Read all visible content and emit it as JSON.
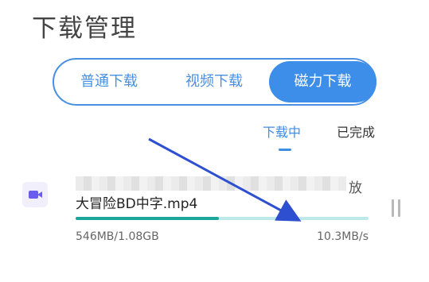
{
  "header": {
    "title": "下载管理"
  },
  "segmented": {
    "tabs": [
      {
        "label": "普通下载"
      },
      {
        "label": "视频下载"
      },
      {
        "label": "磁力下载"
      }
    ],
    "active": "磁力下载"
  },
  "subtabs": {
    "downloading": "下载中",
    "completed": "已完成"
  },
  "download_item": {
    "icon": "video-camera-icon",
    "filename": "大冒险BD中字.mp4",
    "blurred_suffix": "放",
    "downloaded_size": "546MB/1.08GB",
    "speed": "10.3MB/s",
    "progress_fraction": 0.49
  },
  "colors": {
    "accent": "#3d8ee8",
    "progress": "#1aa79a",
    "arrow": "#2f4fd1"
  }
}
